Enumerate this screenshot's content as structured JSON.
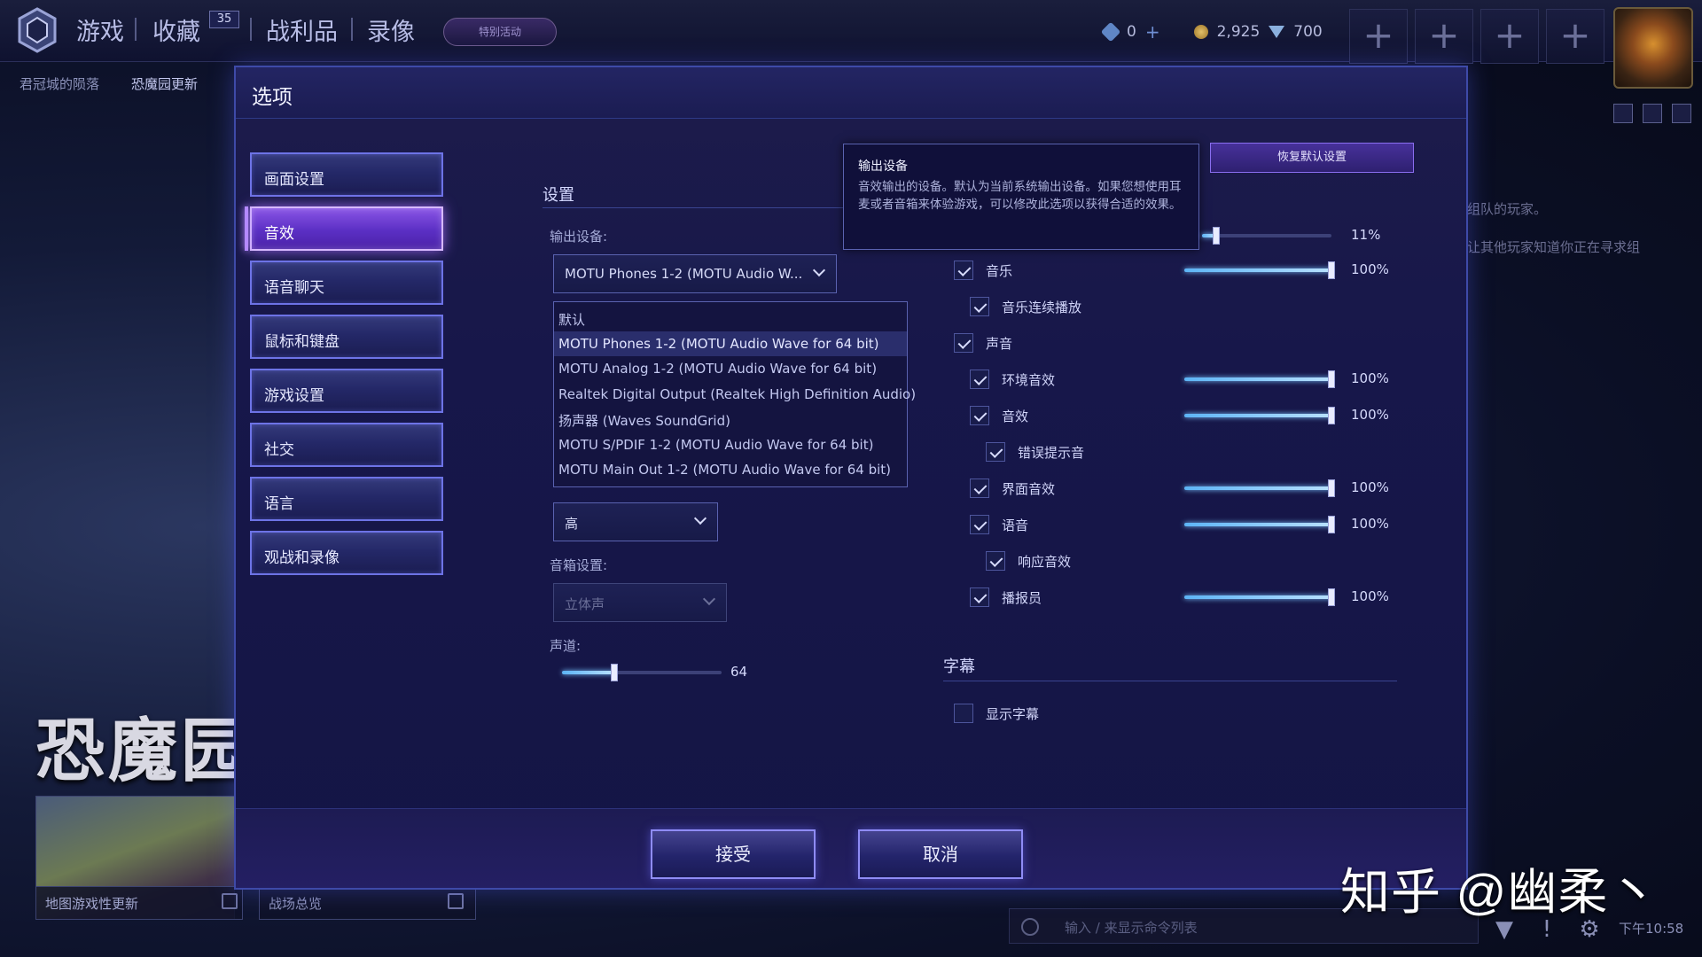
{
  "topbar": {
    "nav": [
      "游戏",
      "收藏",
      "战利品",
      "录像"
    ],
    "collection_badge": "35",
    "event_label": "特别活动",
    "currency": {
      "gems": "0",
      "gold": "2,925",
      "shards": "700"
    }
  },
  "subnav": [
    "君冠城的陨落",
    "恐魔园更新"
  ],
  "background": {
    "big_title": "恐魔园",
    "map_caption": "地图游戏性更新",
    "field_caption": "战场总览",
    "side_text_1": "组队的玩家。",
    "side_text_2": "让其他玩家知道你正在寻求组",
    "chat_placeholder": "输入 / 来显示命令列表",
    "clock": "下午10:58",
    "watermark": "知乎 @幽柔丶"
  },
  "dialog": {
    "title": "选项",
    "categories": [
      "画面设置",
      "音效",
      "语音聊天",
      "鼠标和键盘",
      "游戏设置",
      "社交",
      "语言",
      "观战和录像"
    ],
    "active_category": "音效",
    "settings_header": "设置",
    "output_label": "输出设备:",
    "output_value": "MOTU Phones 1-2 (MOTU Audio W...",
    "output_options": [
      "默认",
      "MOTU Phones 1-2 (MOTU Audio Wave for 64 bit)",
      "MOTU Analog 1-2 (MOTU Audio Wave for 64 bit)",
      "Realtek Digital Output (Realtek High Definition Audio)",
      "扬声器 (Waves SoundGrid)",
      "MOTU S/PDIF 1-2 (MOTU Audio Wave for 64 bit)",
      "MOTU Main Out 1-2 (MOTU Audio Wave for 64 bit)"
    ],
    "quality_value": "高",
    "speaker_label": "音箱设置:",
    "speaker_value": "立体声",
    "channels_label": "声道:",
    "channels_value": "64",
    "channels_fraction": 0.33,
    "tooltip": {
      "title": "输出设备",
      "body": "音效输出的设备。默认为当前系统输出设备。如果您想使用耳麦或者音箱来体验游戏，可以修改此选项以获得合适的效果。"
    },
    "reset_label": "恢复默认设置",
    "master_pct": "11%",
    "master_fraction": 0.11,
    "volume_items": [
      {
        "label": "音乐",
        "checked": true,
        "pct": "100%"
      },
      {
        "label": "音乐连续播放",
        "checked": true
      },
      {
        "label": "声音",
        "checked": true
      },
      {
        "label": "环境音效",
        "checked": true,
        "pct": "100%"
      },
      {
        "label": "音效",
        "checked": true,
        "pct": "100%"
      },
      {
        "label": "错误提示音",
        "checked": true
      },
      {
        "label": "界面音效",
        "checked": true,
        "pct": "100%"
      },
      {
        "label": "语音",
        "checked": true,
        "pct": "100%"
      },
      {
        "label": "响应音效",
        "checked": true
      },
      {
        "label": "播报员",
        "checked": true,
        "pct": "100%"
      }
    ],
    "subtitles_header": "字幕",
    "show_subtitles_label": "显示字幕",
    "show_subtitles": false,
    "accept_label": "接受",
    "cancel_label": "取消"
  }
}
